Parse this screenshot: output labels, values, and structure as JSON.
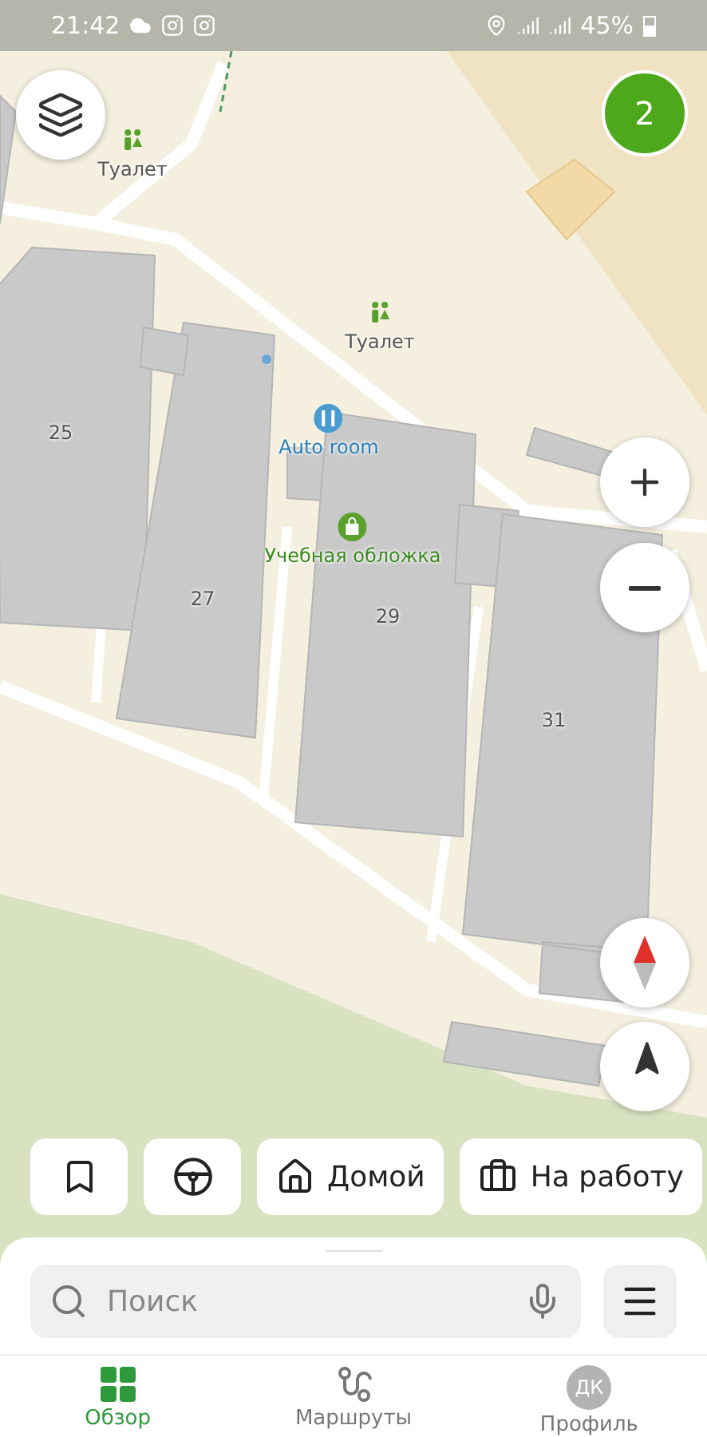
{
  "status_bar": {
    "time": "21:42",
    "battery": "45%"
  },
  "map": {
    "labels": [
      {
        "kind": "toilet",
        "text": "Туалет"
      },
      {
        "kind": "toilet",
        "text": "Туалет"
      },
      {
        "kind": "service",
        "text": "Auto room"
      },
      {
        "kind": "shop",
        "text": "Учебная обложка"
      },
      {
        "kind": "building",
        "text": "25"
      },
      {
        "kind": "building",
        "text": "27"
      },
      {
        "kind": "building",
        "text": "29"
      },
      {
        "kind": "building",
        "text": "31"
      }
    ]
  },
  "notification_badge": "2",
  "quick_buttons": [
    {
      "kind": "bookmark"
    },
    {
      "kind": "car"
    },
    {
      "kind": "home",
      "label": "Домой"
    },
    {
      "kind": "work",
      "label": "На работу"
    }
  ],
  "search": {
    "placeholder": "Поиск"
  },
  "nav": [
    {
      "kind": "overview",
      "label": "Обзор",
      "selected": true
    },
    {
      "kind": "routes",
      "label": "Маршруты",
      "selected": false
    },
    {
      "kind": "profile",
      "label": "Профиль",
      "selected": false,
      "initials": "ДК"
    }
  ]
}
